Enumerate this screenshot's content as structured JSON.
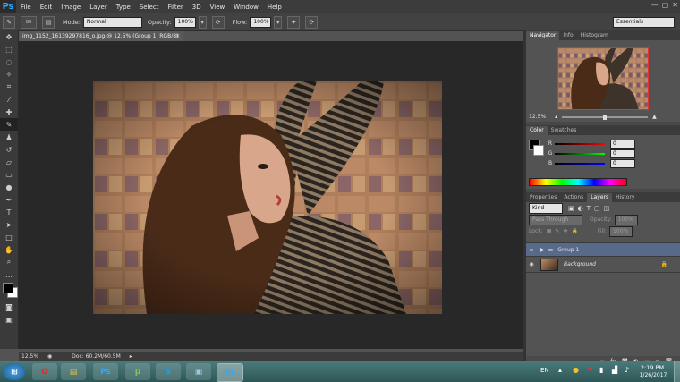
{
  "app": {
    "logo": "Ps"
  },
  "menu": [
    "File",
    "Edit",
    "Image",
    "Layer",
    "Type",
    "Select",
    "Filter",
    "3D",
    "View",
    "Window",
    "Help"
  ],
  "window_controls": [
    "—",
    "▢",
    "✕"
  ],
  "options": {
    "brush_size": "80",
    "mode_label": "Mode:",
    "mode_value": "Normal",
    "opacity_label": "Opacity:",
    "opacity_value": "100%",
    "flow_label": "Flow:",
    "flow_value": "100%",
    "workspace": "Essentials"
  },
  "tools": [
    "move",
    "marquee",
    "lasso",
    "quick-select",
    "crop",
    "eyedropper",
    "healing",
    "brush",
    "stamp",
    "history-brush",
    "eraser",
    "gradient",
    "dodge",
    "pen",
    "type",
    "path-select",
    "shape",
    "hand",
    "zoom"
  ],
  "document": {
    "tab_title": "img_1152_16139297816_o.jpg @ 12.5% (Group 1, RGB/8) *",
    "close": "×"
  },
  "status": {
    "zoom": "12.5%",
    "doc": "Doc: 60.2M/60.5M"
  },
  "navigator": {
    "tabs": [
      "Navigator",
      "Info",
      "Histogram"
    ],
    "zoom": "12.5%"
  },
  "color_panel": {
    "tabs": [
      "Color",
      "Swatches"
    ],
    "r_label": "R",
    "r_value": "0",
    "g_label": "G",
    "g_value": "0",
    "b_label": "B",
    "b_value": "0"
  },
  "layers_panel": {
    "tabs": [
      "Properties",
      "Actions",
      "Layers",
      "History"
    ],
    "filter": "Kind",
    "blend_mode": "Pass Through",
    "opacity_label": "Opacity:",
    "opacity_value": "100%",
    "lock_label": "Lock:",
    "fill_label": "Fill:",
    "fill_value": "100%",
    "layers": [
      {
        "name": "Group 1"
      },
      {
        "name": "Background"
      }
    ],
    "footer_icons": [
      "link-icon",
      "fx-icon",
      "mask-icon",
      "adjustment-icon",
      "folder-icon",
      "new-layer-icon",
      "trash-icon"
    ]
  },
  "taskbar": {
    "lang": "EN",
    "time": "2:19 PM",
    "date": "1/26/2017",
    "apps": [
      "start",
      "opera",
      "explorer",
      "photoshop",
      "utorrent",
      "skype",
      "photos",
      "photoshop-active"
    ]
  },
  "colors": {
    "accent": "#31a8ff",
    "selection": "#586a8a"
  }
}
